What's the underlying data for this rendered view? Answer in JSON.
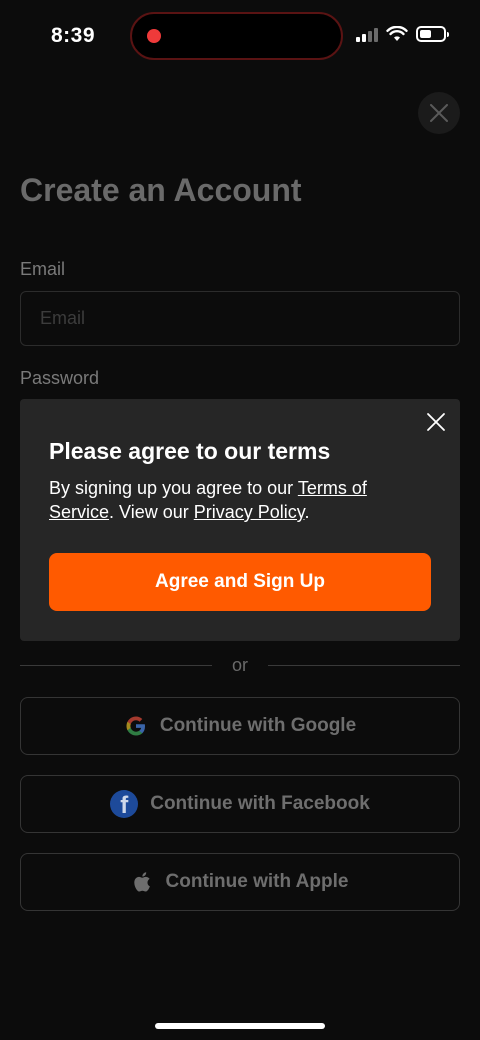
{
  "status_bar": {
    "time": "8:39"
  },
  "page": {
    "title": "Create an Account",
    "email_label": "Email",
    "email_placeholder": "Email",
    "password_label": "Password",
    "divider_text": "or",
    "google_label": "Continue with Google",
    "facebook_label": "Continue with Facebook",
    "apple_label": "Continue with Apple"
  },
  "modal": {
    "title": "Please agree to our terms",
    "body_prefix": "By signing up you agree to our ",
    "terms_link": "Terms of Service",
    "body_middle": ". View our ",
    "privacy_link": "Privacy Policy",
    "body_suffix": ".",
    "agree_button": "Agree and Sign Up"
  },
  "colors": {
    "accent": "#ff5a00",
    "background": "#0c0c0c",
    "modal_bg": "#262626",
    "recording": "#ef3a3a"
  },
  "icons": {
    "close": "close-icon",
    "google": "google-icon",
    "facebook": "facebook-icon",
    "apple": "apple-icon",
    "wifi": "wifi-icon",
    "battery": "battery-icon",
    "signal": "signal-icon"
  }
}
